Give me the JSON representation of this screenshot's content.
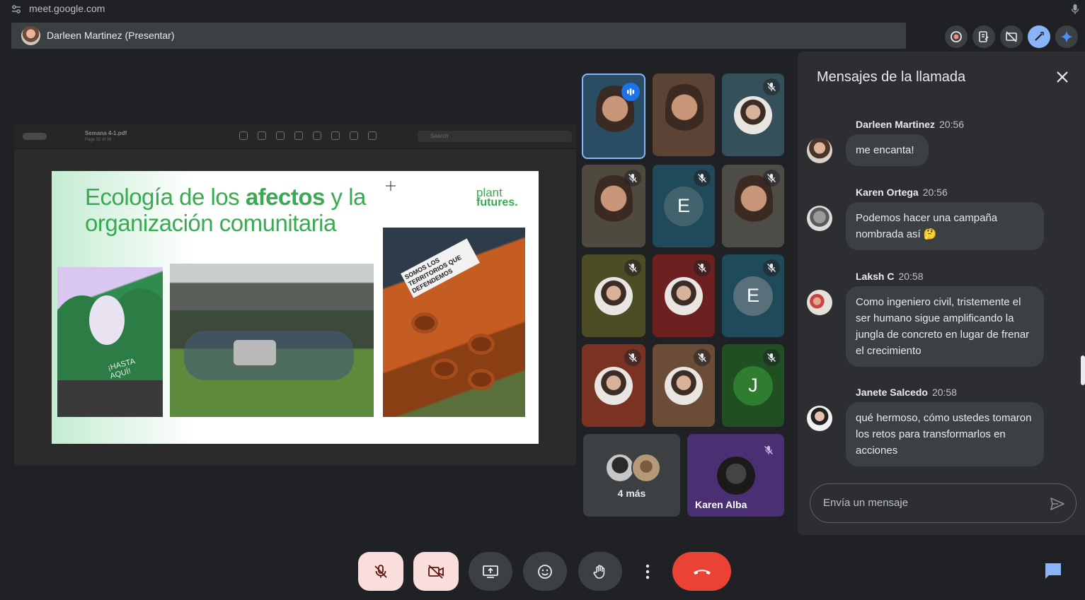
{
  "browser": {
    "url": "meet.google.com"
  },
  "presenter": {
    "label": "Darleen Martinez (Presentar)"
  },
  "top_icons": [
    "record-icon",
    "notes-icon",
    "no-share-icon",
    "pen-icon",
    "gemini-icon"
  ],
  "shared_screen": {
    "file_name": "Semana 4-1.pdf",
    "page_info": "Page 32 of 36",
    "search_placeholder": "Search",
    "slide": {
      "title_line1_pre": "Ecología de los ",
      "title_line1_bold": "afectos",
      "title_line1_post": " y la",
      "title_line2": "organización comunitaria",
      "logo_line1": "plant",
      "logo_line2": "futures.",
      "image_text_1": "¡HASTA AQUÍ!",
      "image_text_3": "SOMOS LOS TERRITORIOS QUE DEFENDEMOS"
    }
  },
  "participants": [
    {
      "kind": "video",
      "speaking": true,
      "bg": "#2b4d63"
    },
    {
      "kind": "video",
      "bg": "#5b4436"
    },
    {
      "kind": "avatar",
      "muted": true,
      "bg": "#34505b"
    },
    {
      "kind": "video",
      "muted": true,
      "bg": "#4f4a3e"
    },
    {
      "kind": "letter",
      "letter": "E",
      "muted": true,
      "bg": "#1f4a5a",
      "circle": "#42626e"
    },
    {
      "kind": "video",
      "muted": true,
      "bg": "#4e4c47"
    },
    {
      "kind": "avatar",
      "muted": true,
      "bg": "#4d4d25"
    },
    {
      "kind": "avatar",
      "muted": true,
      "bg": "#6d2020"
    },
    {
      "kind": "letter",
      "letter": "E",
      "muted": true,
      "bg": "#1f4a5a",
      "circle": "#587079"
    },
    {
      "kind": "avatar",
      "muted": true,
      "bg": "#7a3322"
    },
    {
      "kind": "avatar",
      "muted": true,
      "bg": "#6a4c37"
    },
    {
      "kind": "letter",
      "letter": "J",
      "muted": true,
      "bg": "#205021",
      "circle": "#2f7d31"
    }
  ],
  "more_tile": {
    "label": "4 más"
  },
  "karen_tile": {
    "name": "Karen Alba"
  },
  "chat": {
    "title": "Mensajes de la llamada",
    "composer_placeholder": "Envía un mensaje",
    "messages": [
      {
        "author": "Darleen Martinez",
        "time": "20:56",
        "text": "me encanta!"
      },
      {
        "author": "Karen Ortega",
        "time": "20:56",
        "text": "Podemos hacer una campaña nombrada así 🤔"
      },
      {
        "author": "Laksh C",
        "time": "20:58",
        "text": "Como ingeniero civil, tristemente el ser humano sigue amplificando la jungla de concreto en lugar de frenar el crecimiento"
      },
      {
        "author": "Janete Salcedo",
        "time": "20:58",
        "text": "qué hermoso, cómo ustedes tomaron los retos para transformarlos en acciones"
      }
    ]
  },
  "controls": [
    "mic-off-icon",
    "camera-off-icon",
    "present-screen-icon",
    "emoji-icon",
    "raise-hand-icon",
    "more-options-icon",
    "end-call-icon"
  ],
  "colors": {
    "accent": "#8ab4f8",
    "end_call": "#ea4335",
    "slide_green": "#3aaa52",
    "muted_control_bg": "#f9dedc"
  }
}
